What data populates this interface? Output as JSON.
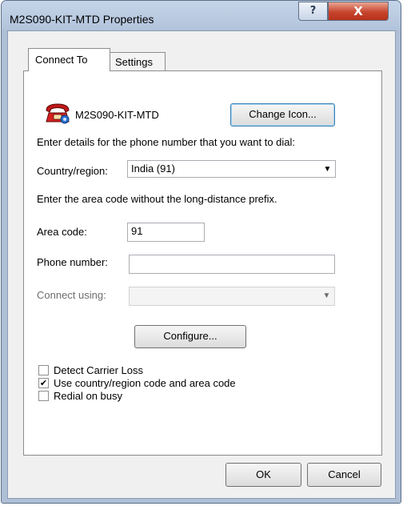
{
  "window": {
    "title": "M2S090-KIT-MTD Properties",
    "help_glyph": "?",
    "close_glyph": "X"
  },
  "tabs": [
    {
      "label": "Connect To",
      "selected": true
    },
    {
      "label": "Settings",
      "selected": false
    }
  ],
  "connection": {
    "name": "M2S090-KIT-MTD",
    "icon": "phone-icon",
    "change_icon_label": "Change Icon...",
    "instruction": "Enter details for the phone number that you want to dial:",
    "country_label": "Country/region:",
    "country_value": "India (91)",
    "area_instruction": "Enter the area code without the long-distance prefix.",
    "area_code_label": "Area code:",
    "area_code_value": "91",
    "phone_label": "Phone number:",
    "phone_value": "",
    "connect_using_label": "Connect using:",
    "connect_using_value": "",
    "configure_label": "Configure..."
  },
  "options": [
    {
      "label": "Detect Carrier Loss",
      "checked": false
    },
    {
      "label": "Use country/region code and area code",
      "checked": true
    },
    {
      "label": "Redial on busy",
      "checked": false
    }
  ],
  "footer": {
    "ok_label": "OK",
    "cancel_label": "Cancel"
  },
  "colors": {
    "title_bar": "#b9c9df",
    "close_button": "#c8452d",
    "dialog_background": "#f0f0f0"
  }
}
